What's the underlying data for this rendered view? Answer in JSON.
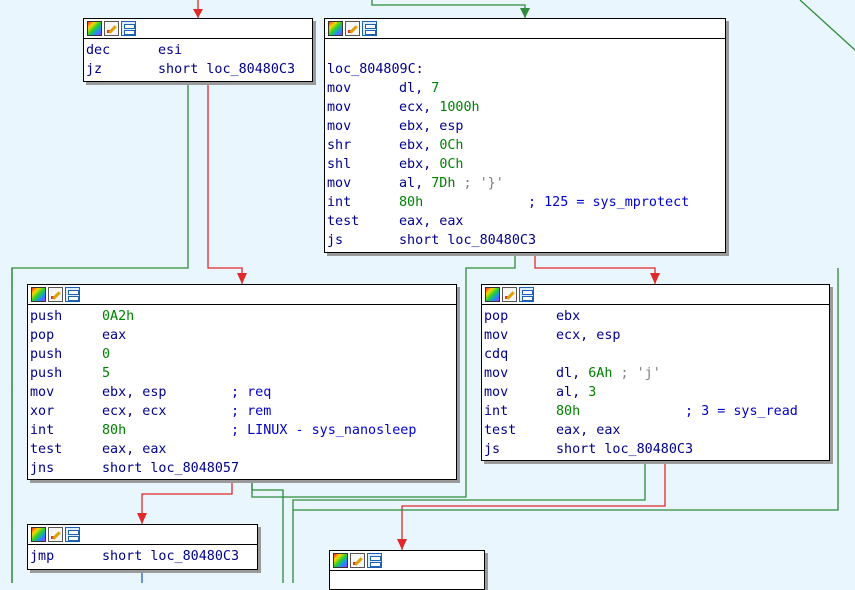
{
  "colors": {
    "background": "#eaf6fd",
    "edge_true": "#2e8b3c",
    "edge_false": "#e02a2a",
    "edge_uncond": "#1f5fc0",
    "mnemonic": "#00008b",
    "immediate": "#008000",
    "comment": "#0000cc",
    "char_comment": "#808080"
  },
  "nodes": {
    "n1": {
      "lines": [
        {
          "mn": "dec",
          "op": "esi"
        },
        {
          "mn": "jz",
          "op": "short loc_80480C3"
        }
      ]
    },
    "n2": {
      "label": "loc_804809C:",
      "lines": [
        {
          "mn": "mov",
          "op": "dl, ",
          "num": "7"
        },
        {
          "mn": "mov",
          "op": "ecx, ",
          "num": "1000h"
        },
        {
          "mn": "mov",
          "op": "ebx, esp"
        },
        {
          "mn": "shr",
          "op": "ebx, ",
          "num": "0Ch"
        },
        {
          "mn": "shl",
          "op": "ebx, ",
          "num": "0Ch"
        },
        {
          "mn": "mov",
          "op": "al, ",
          "num": "7Dh",
          "cm": " ; '}'"
        },
        {
          "mn": "int",
          "op": "",
          "num": "80h",
          "pad": "             ",
          "cmt": "; 125 = sys_mprotect"
        },
        {
          "mn": "test",
          "op": "eax, eax"
        },
        {
          "mn": "js",
          "op": "short loc_80480C3"
        }
      ]
    },
    "n3": {
      "lines": [
        {
          "mn": "push",
          "op": "",
          "num": "0A2h"
        },
        {
          "mn": "pop",
          "op": "eax"
        },
        {
          "mn": "push",
          "op": "",
          "num": "0"
        },
        {
          "mn": "push",
          "op": "",
          "num": "5"
        },
        {
          "mn": "mov",
          "op": "ebx, esp",
          "pad": "        ",
          "cmt": "; req"
        },
        {
          "mn": "xor",
          "op": "ecx, ecx",
          "pad": "        ",
          "cmt": "; rem"
        },
        {
          "mn": "int",
          "op": "",
          "num": "80h",
          "pad": "             ",
          "cmt": "; LINUX - sys_nanosleep"
        },
        {
          "mn": "test",
          "op": "eax, eax"
        },
        {
          "mn": "jns",
          "op": "short loc_8048057"
        }
      ]
    },
    "n4": {
      "lines": [
        {
          "mn": "pop",
          "op": "ebx"
        },
        {
          "mn": "mov",
          "op": "ecx, esp"
        },
        {
          "mn": "cdq",
          "op": ""
        },
        {
          "mn": "mov",
          "op": "dl, ",
          "num": "6Ah",
          "cm": " ; 'j'"
        },
        {
          "mn": "mov",
          "op": "al, ",
          "num": "3"
        },
        {
          "mn": "int",
          "op": "",
          "num": "80h",
          "pad": "             ",
          "cmt": "; 3 = sys_read"
        },
        {
          "mn": "test",
          "op": "eax, eax"
        },
        {
          "mn": "js",
          "op": "short loc_80480C3"
        }
      ]
    },
    "n5": {
      "lines": [
        {
          "mn": "jmp",
          "op": "short loc_80480C3"
        }
      ]
    },
    "n6": {
      "lines": []
    }
  }
}
